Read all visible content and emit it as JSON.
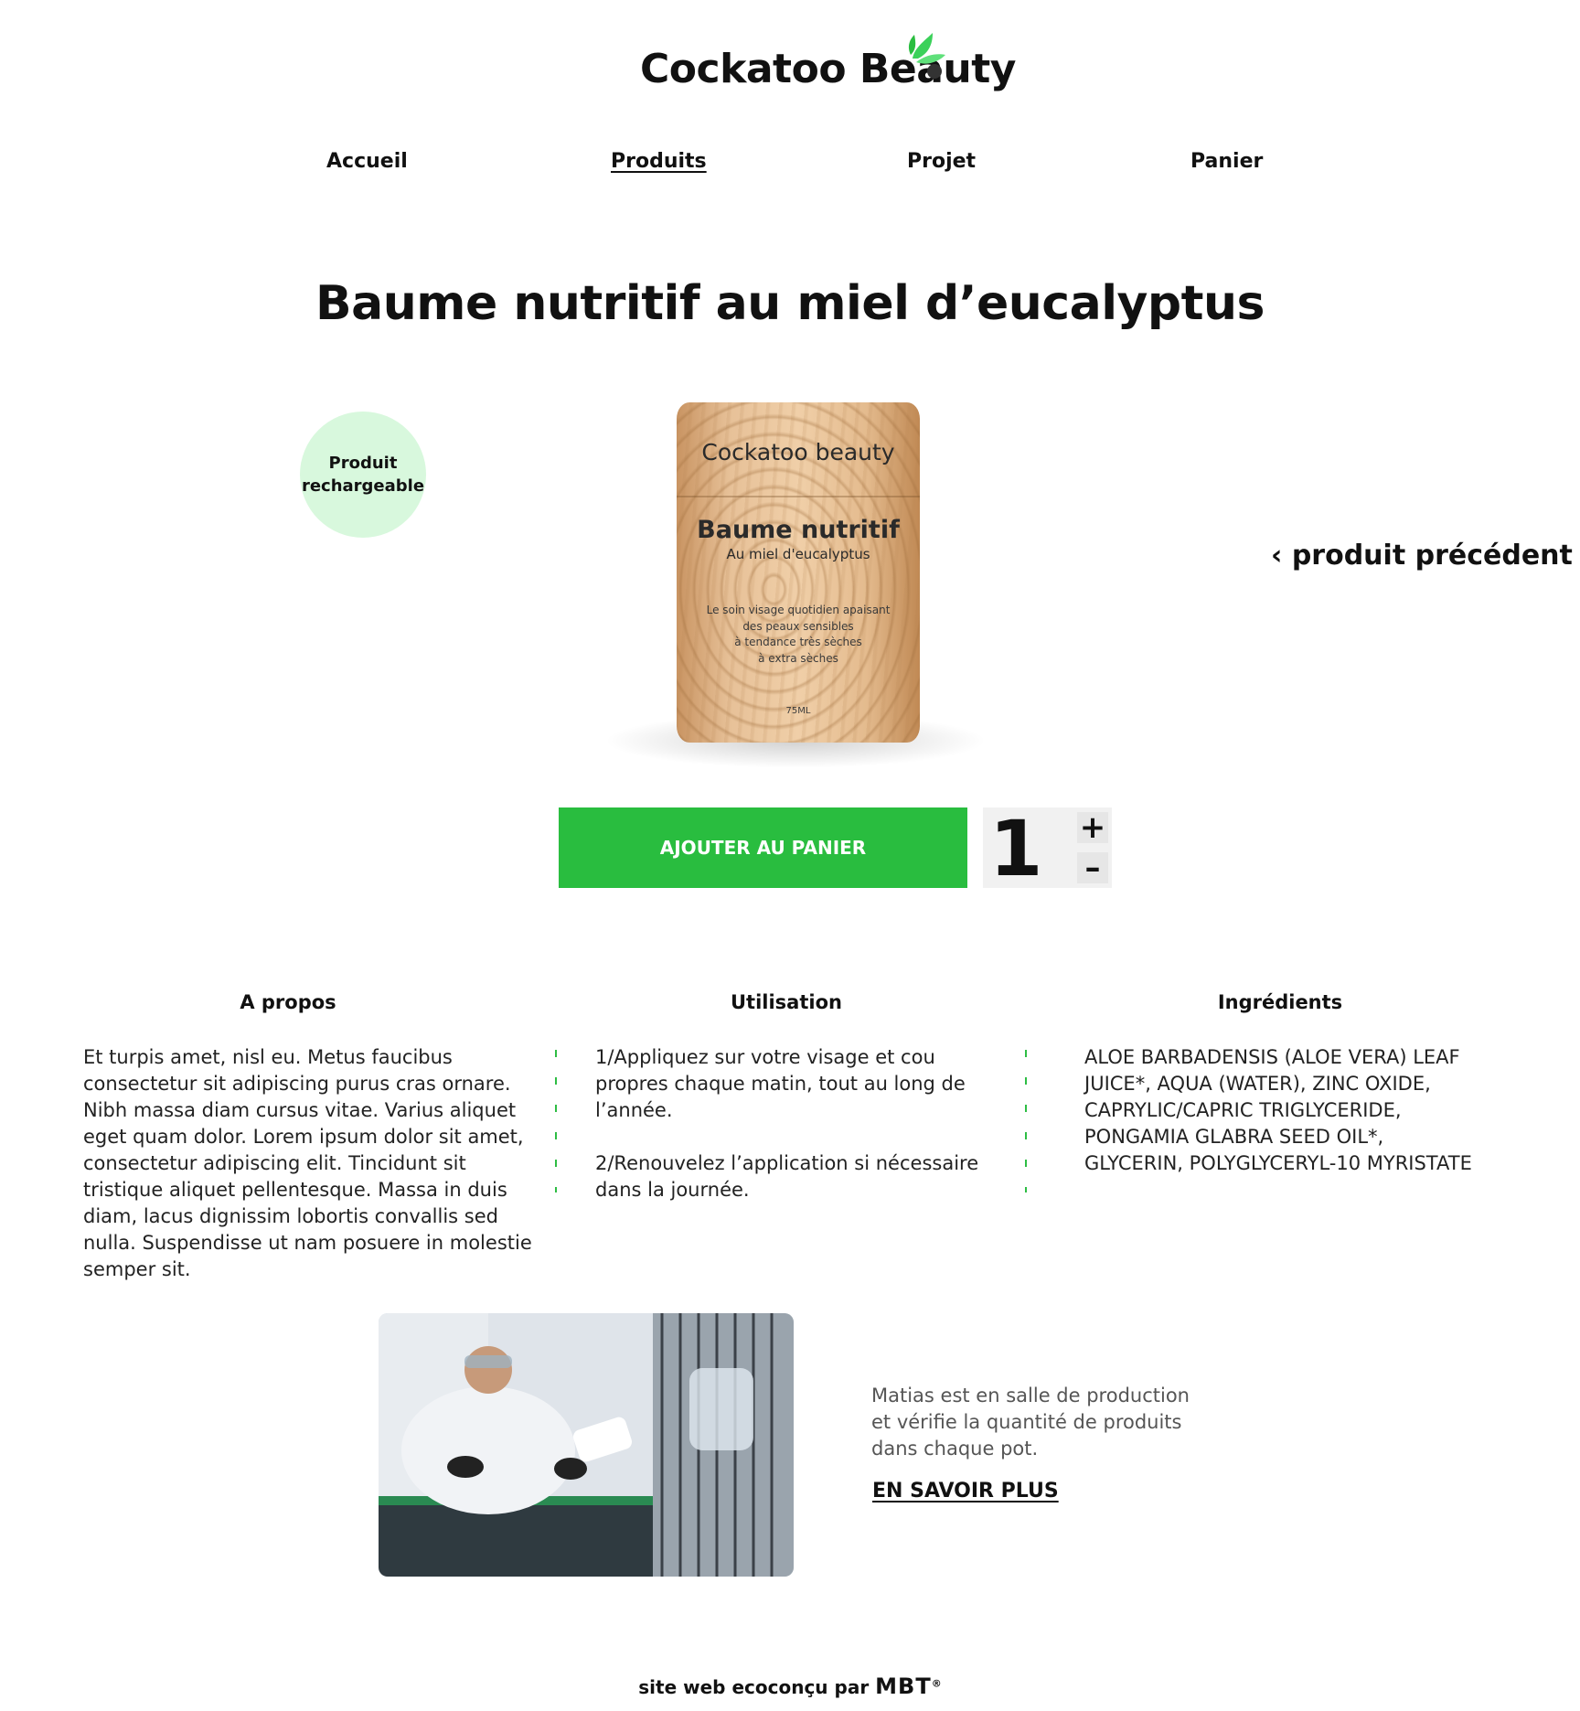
{
  "header": {
    "logo": "Cockatoo Beauty"
  },
  "nav": {
    "items": [
      {
        "label": "Accueil"
      },
      {
        "label": "Produits"
      },
      {
        "label": "Projet"
      },
      {
        "label": "Panier"
      }
    ],
    "active": "Produits"
  },
  "product": {
    "title": "Baume nutritif au miel d’eucalyptus",
    "badge_line1": "Produit",
    "badge_line2": "rechargeable",
    "jar": {
      "brand": "Cockatoo beauty",
      "name": "Baume nutritif",
      "subtitle": "Au miel d'eucalyptus",
      "desc_line1": "Le soin visage quotidien apaisant",
      "desc_line2": "des peaux sensibles",
      "desc_line3": "à tendance très sèches",
      "desc_line4": "à extra sèches",
      "volume": "75ML"
    },
    "prev_label": "produit précédent",
    "prev_arrow": "‹"
  },
  "cart": {
    "add_label": "AJOUTER AU PANIER",
    "quantity": "1",
    "plus": "+",
    "minus": "–"
  },
  "sections": {
    "about": {
      "title": "A propos",
      "text": "Et turpis amet, nisl eu. Metus faucibus consectetur sit adipiscing purus cras ornare. Nibh massa diam cursus vitae. Varius aliquet eget quam dolor. Lorem ipsum dolor sit amet, consectetur adipiscing elit. Tincidunt sit tristique aliquet pellentesque. Massa in duis diam, lacus dignissim lobortis convallis sed nulla. Suspendisse ut nam posuere in molestie semper sit."
    },
    "usage": {
      "title": "Utilisation",
      "step1": "1/Appliquez sur votre visage et cou propres chaque matin, tout au long de l’année.",
      "step2": "2/Renouvelez l’application si nécessaire dans la journée."
    },
    "ingredients": {
      "title": "Ingrédients",
      "text": "ALOE BARBADENSIS (ALOE VERA) LEAF JUICE*, AQUA (WATER), ZINC OXIDE, CAPRYLIC/CAPRIC TRIGLYCERIDE, PONGAMIA GLABRA SEED OIL*, GLYCERIN, POLYGLYCERYL-10 MYRISTATE"
    }
  },
  "story": {
    "text": "Matias est en salle de production et vérifie la quantité de produits dans chaque pot.",
    "link": "EN SAVOIR PLUS"
  },
  "footer": {
    "prefix": "site web ecoconçu par",
    "brand": "MBT",
    "mark": "®"
  },
  "colors": {
    "accent_green": "#29bd3f",
    "badge_bg": "#d8f8dd",
    "divider_green": "#2ebd44"
  }
}
